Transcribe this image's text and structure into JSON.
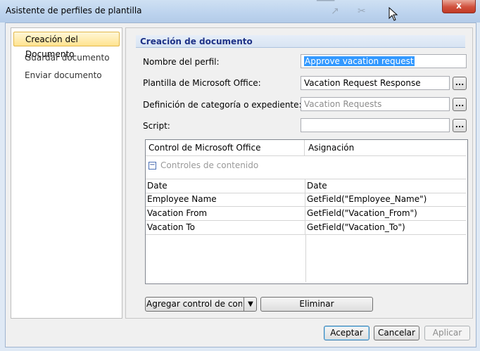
{
  "window": {
    "title": "Asistente de perfiles de plantilla",
    "close_glyph": "x"
  },
  "nav": {
    "items": [
      {
        "label": "Creación del Documento",
        "active": true
      },
      {
        "label": "Guardar documento",
        "active": false
      },
      {
        "label": "Enviar documento",
        "active": false
      }
    ]
  },
  "section": {
    "title": "Creación de documento"
  },
  "form": {
    "profile_name": {
      "label": "Nombre del perfil:",
      "value": "Approve vacation request"
    },
    "template": {
      "label": "Plantilla de Microsoft Office:",
      "value": "Vacation Request Response",
      "browse": "..."
    },
    "category": {
      "label": "Definición de categoría o expediente:",
      "value": "Vacation Requests",
      "browse": "..."
    },
    "script": {
      "label": "Script:",
      "value": "",
      "browse": "..."
    }
  },
  "grid": {
    "columns": [
      "Control de Microsoft Office",
      "Asignación"
    ],
    "group": {
      "toggle": "−",
      "label": "Controles de contenido"
    },
    "rows": [
      {
        "control": "Date",
        "mapping": "Date"
      },
      {
        "control": "Employee Name",
        "mapping": "GetField(\"Employee_Name\")"
      },
      {
        "control": "Vacation From",
        "mapping": "GetField(\"Vacation_From\")"
      },
      {
        "control": "Vacation To",
        "mapping": "GetField(\"Vacation_To\")"
      }
    ]
  },
  "actions": {
    "add_control": "Agregar control de contenido",
    "remove": "Eliminar"
  },
  "footer": {
    "ok": "Aceptar",
    "cancel": "Cancelar",
    "apply": "Aplicar"
  }
}
